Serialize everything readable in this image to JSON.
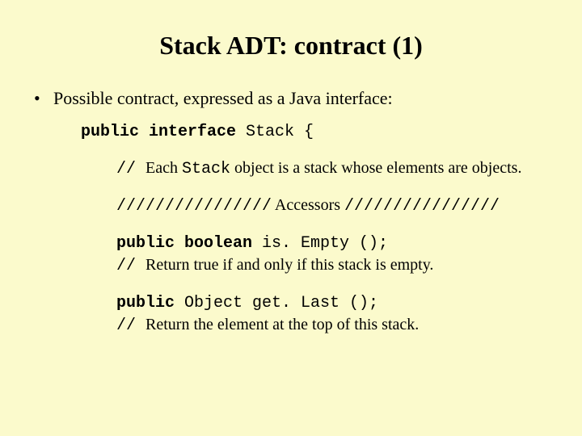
{
  "title": "Stack ADT: contract (1)",
  "bullet1": "Possible contract, expressed as a Java interface:",
  "sig_kw": "public interface",
  "sig_name": " Stack {",
  "c1_a": "// ",
  "c1_b": " Each ",
  "c1_c": "Stack",
  "c1_d": " object is a stack whose elements are objects.",
  "sep_a": "////////////////",
  "sep_b": "  Accessors  ",
  "sep_c": "////////////////",
  "m1_kw": "public boolean",
  "m1_rest": " is. Empty ();",
  "m1c_a": "// ",
  "m1c_b": " Return true if and only if this stack is empty.",
  "m2_kw": "public",
  "m2_rest": " Object get. Last ();",
  "m2c_a": "// ",
  "m2c_b": " Return the element at the top of this stack."
}
